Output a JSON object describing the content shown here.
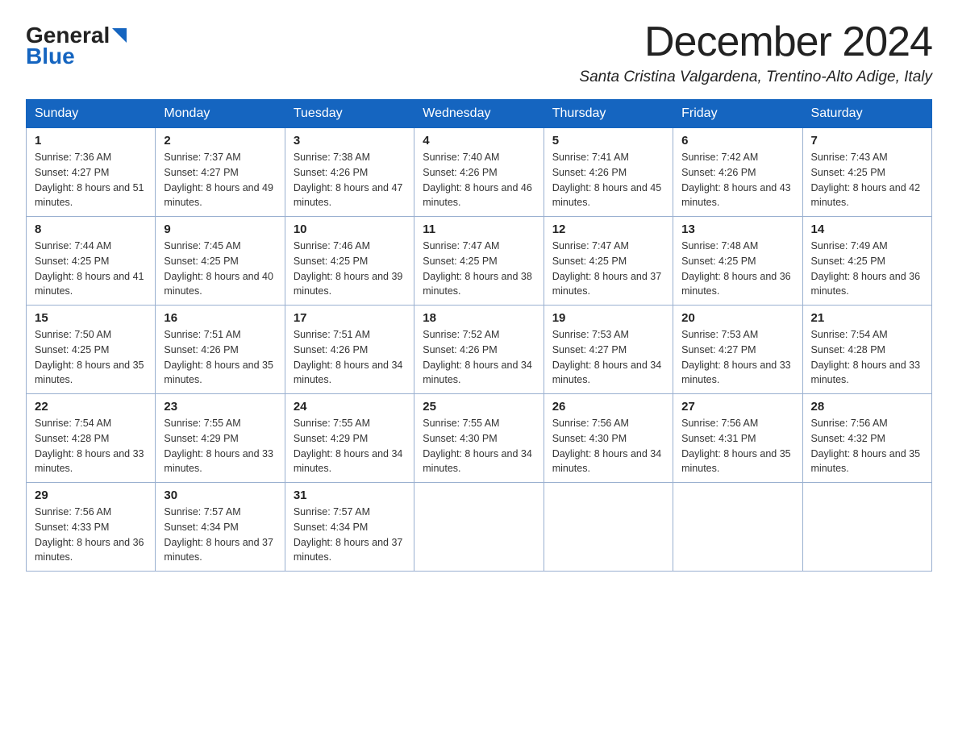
{
  "logo": {
    "general": "General",
    "blue": "Blue"
  },
  "title": "December 2024",
  "subtitle": "Santa Cristina Valgardena, Trentino-Alto Adige, Italy",
  "headers": [
    "Sunday",
    "Monday",
    "Tuesday",
    "Wednesday",
    "Thursday",
    "Friday",
    "Saturday"
  ],
  "weeks": [
    [
      {
        "day": "1",
        "sunrise": "7:36 AM",
        "sunset": "4:27 PM",
        "daylight": "8 hours and 51 minutes."
      },
      {
        "day": "2",
        "sunrise": "7:37 AM",
        "sunset": "4:27 PM",
        "daylight": "8 hours and 49 minutes."
      },
      {
        "day": "3",
        "sunrise": "7:38 AM",
        "sunset": "4:26 PM",
        "daylight": "8 hours and 47 minutes."
      },
      {
        "day": "4",
        "sunrise": "7:40 AM",
        "sunset": "4:26 PM",
        "daylight": "8 hours and 46 minutes."
      },
      {
        "day": "5",
        "sunrise": "7:41 AM",
        "sunset": "4:26 PM",
        "daylight": "8 hours and 45 minutes."
      },
      {
        "day": "6",
        "sunrise": "7:42 AM",
        "sunset": "4:26 PM",
        "daylight": "8 hours and 43 minutes."
      },
      {
        "day": "7",
        "sunrise": "7:43 AM",
        "sunset": "4:25 PM",
        "daylight": "8 hours and 42 minutes."
      }
    ],
    [
      {
        "day": "8",
        "sunrise": "7:44 AM",
        "sunset": "4:25 PM",
        "daylight": "8 hours and 41 minutes."
      },
      {
        "day": "9",
        "sunrise": "7:45 AM",
        "sunset": "4:25 PM",
        "daylight": "8 hours and 40 minutes."
      },
      {
        "day": "10",
        "sunrise": "7:46 AM",
        "sunset": "4:25 PM",
        "daylight": "8 hours and 39 minutes."
      },
      {
        "day": "11",
        "sunrise": "7:47 AM",
        "sunset": "4:25 PM",
        "daylight": "8 hours and 38 minutes."
      },
      {
        "day": "12",
        "sunrise": "7:47 AM",
        "sunset": "4:25 PM",
        "daylight": "8 hours and 37 minutes."
      },
      {
        "day": "13",
        "sunrise": "7:48 AM",
        "sunset": "4:25 PM",
        "daylight": "8 hours and 36 minutes."
      },
      {
        "day": "14",
        "sunrise": "7:49 AM",
        "sunset": "4:25 PM",
        "daylight": "8 hours and 36 minutes."
      }
    ],
    [
      {
        "day": "15",
        "sunrise": "7:50 AM",
        "sunset": "4:25 PM",
        "daylight": "8 hours and 35 minutes."
      },
      {
        "day": "16",
        "sunrise": "7:51 AM",
        "sunset": "4:26 PM",
        "daylight": "8 hours and 35 minutes."
      },
      {
        "day": "17",
        "sunrise": "7:51 AM",
        "sunset": "4:26 PM",
        "daylight": "8 hours and 34 minutes."
      },
      {
        "day": "18",
        "sunrise": "7:52 AM",
        "sunset": "4:26 PM",
        "daylight": "8 hours and 34 minutes."
      },
      {
        "day": "19",
        "sunrise": "7:53 AM",
        "sunset": "4:27 PM",
        "daylight": "8 hours and 34 minutes."
      },
      {
        "day": "20",
        "sunrise": "7:53 AM",
        "sunset": "4:27 PM",
        "daylight": "8 hours and 33 minutes."
      },
      {
        "day": "21",
        "sunrise": "7:54 AM",
        "sunset": "4:28 PM",
        "daylight": "8 hours and 33 minutes."
      }
    ],
    [
      {
        "day": "22",
        "sunrise": "7:54 AM",
        "sunset": "4:28 PM",
        "daylight": "8 hours and 33 minutes."
      },
      {
        "day": "23",
        "sunrise": "7:55 AM",
        "sunset": "4:29 PM",
        "daylight": "8 hours and 33 minutes."
      },
      {
        "day": "24",
        "sunrise": "7:55 AM",
        "sunset": "4:29 PM",
        "daylight": "8 hours and 34 minutes."
      },
      {
        "day": "25",
        "sunrise": "7:55 AM",
        "sunset": "4:30 PM",
        "daylight": "8 hours and 34 minutes."
      },
      {
        "day": "26",
        "sunrise": "7:56 AM",
        "sunset": "4:30 PM",
        "daylight": "8 hours and 34 minutes."
      },
      {
        "day": "27",
        "sunrise": "7:56 AM",
        "sunset": "4:31 PM",
        "daylight": "8 hours and 35 minutes."
      },
      {
        "day": "28",
        "sunrise": "7:56 AM",
        "sunset": "4:32 PM",
        "daylight": "8 hours and 35 minutes."
      }
    ],
    [
      {
        "day": "29",
        "sunrise": "7:56 AM",
        "sunset": "4:33 PM",
        "daylight": "8 hours and 36 minutes."
      },
      {
        "day": "30",
        "sunrise": "7:57 AM",
        "sunset": "4:34 PM",
        "daylight": "8 hours and 37 minutes."
      },
      {
        "day": "31",
        "sunrise": "7:57 AM",
        "sunset": "4:34 PM",
        "daylight": "8 hours and 37 minutes."
      },
      null,
      null,
      null,
      null
    ]
  ],
  "labels": {
    "sunrise": "Sunrise:",
    "sunset": "Sunset:",
    "daylight": "Daylight:"
  }
}
